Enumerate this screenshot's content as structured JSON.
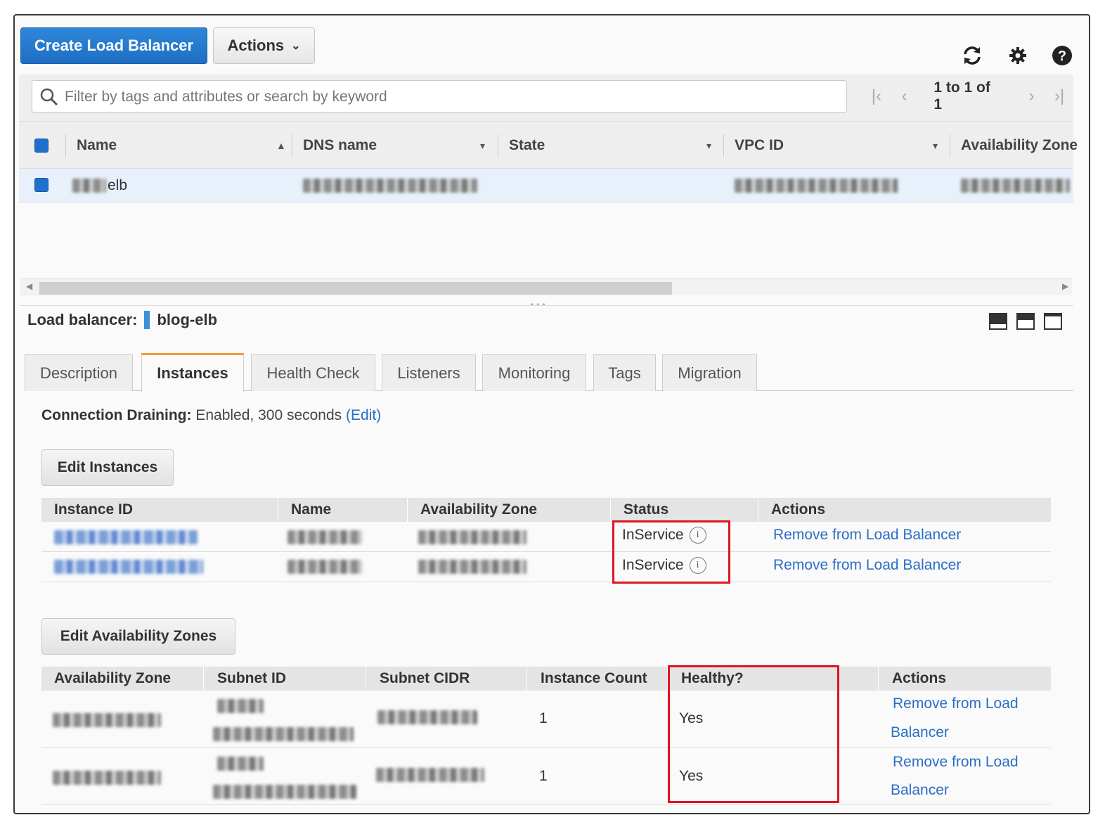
{
  "toolbar": {
    "create_label": "Create Load Balancer",
    "actions_label": "Actions",
    "refresh_icon": "refresh-icon",
    "settings_icon": "gear-icon",
    "help_icon": "help-icon"
  },
  "search": {
    "placeholder": "Filter by tags and attributes or search by keyword"
  },
  "pagination": {
    "text": "1 to 1 of 1"
  },
  "grid": {
    "columns": [
      "Name",
      "DNS name",
      "State",
      "VPC ID",
      "Availability Zone"
    ],
    "rows": [
      {
        "name_suffix": "elb"
      }
    ]
  },
  "detail": {
    "label": "Load balancer:",
    "name": "blog-elb"
  },
  "tabs": [
    "Description",
    "Instances",
    "Health Check",
    "Listeners",
    "Monitoring",
    "Tags",
    "Migration"
  ],
  "active_tab": "Instances",
  "instances": {
    "connection_draining_label": "Connection Draining:",
    "connection_draining_value": "Enabled, 300 seconds",
    "connection_draining_edit": "(Edit)",
    "edit_button": "Edit Instances",
    "columns": [
      "Instance ID",
      "Name",
      "Availability Zone",
      "Status",
      "Actions"
    ],
    "rows": [
      {
        "status": "InService",
        "action": "Remove from Load Balancer"
      },
      {
        "status": "InService",
        "action": "Remove from Load Balancer"
      }
    ]
  },
  "zones": {
    "edit_button": "Edit Availability Zones",
    "columns": [
      "Availability Zone",
      "Subnet ID",
      "Subnet CIDR",
      "Instance Count",
      "Healthy?",
      "Actions"
    ],
    "rows": [
      {
        "instance_count": "1",
        "healthy": "Yes",
        "action_line1": "Remove from Load",
        "action_line2": "Balancer"
      },
      {
        "instance_count": "1",
        "healthy": "Yes",
        "action_line1": "Remove from Load",
        "action_line2": "Balancer"
      }
    ]
  },
  "colors": {
    "primary": "#1e6fc4",
    "link": "#2a6ec6",
    "active_tab_accent": "#f09a36",
    "highlight_box": "#e0141e"
  }
}
